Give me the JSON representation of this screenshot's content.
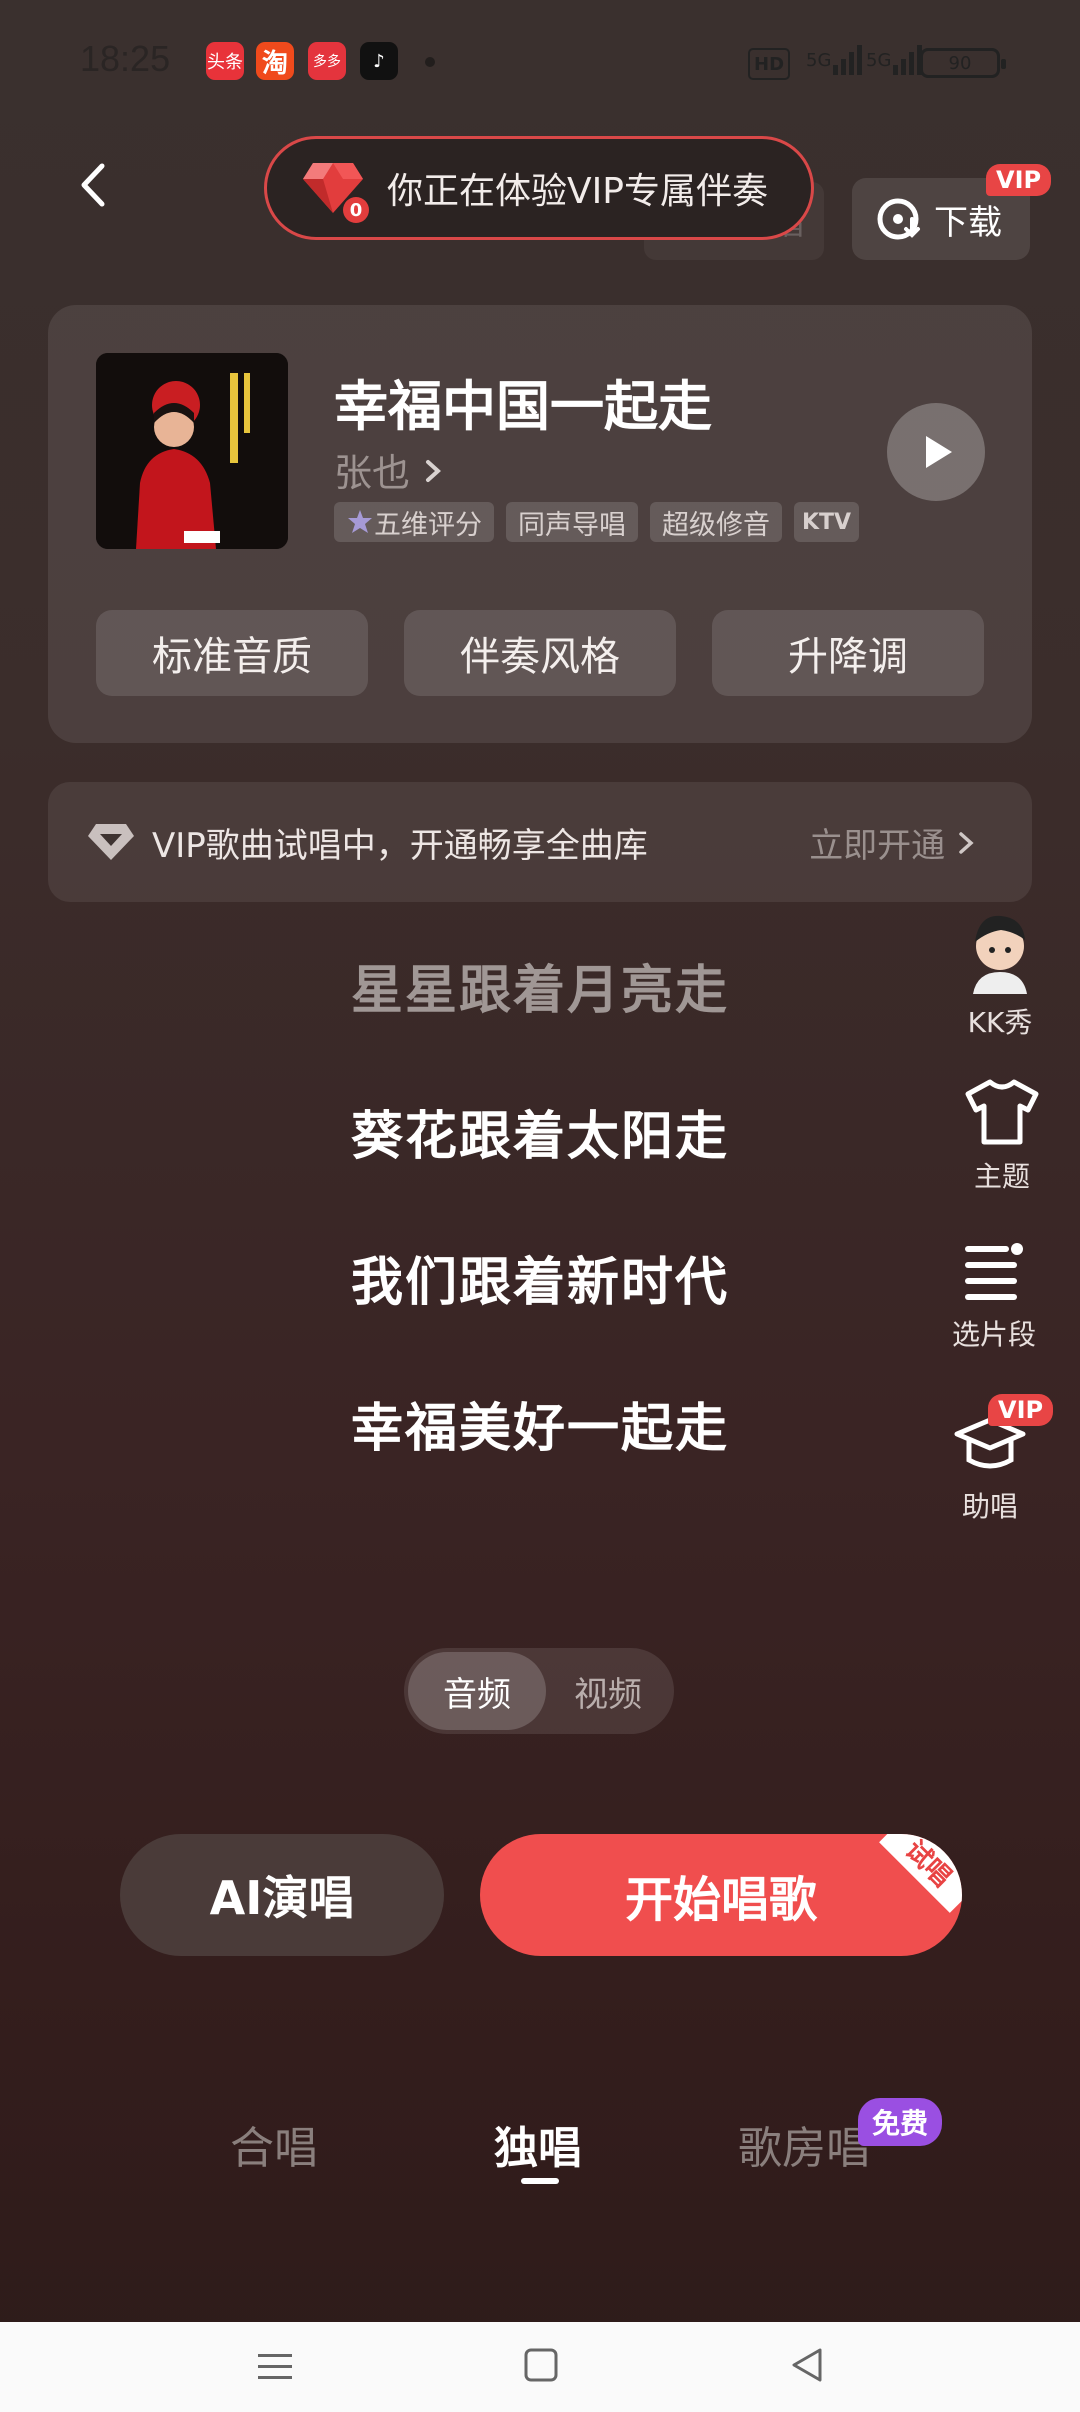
{
  "status_bar": {
    "time": "18:25",
    "apps": [
      {
        "label": "头条",
        "color": "#e8333a"
      },
      {
        "label": "淘",
        "color": "#f04a1c"
      },
      {
        "label": "多多",
        "color": "#e4343d"
      },
      {
        "label": "♪",
        "color": "#111111"
      }
    ],
    "hd": "HD",
    "network1": "5G",
    "network2": "5G",
    "battery": "90"
  },
  "header": {
    "vip_notice": "你正在体验VIP专属伴奏",
    "gem_count": "0",
    "practice_label": "练唱",
    "download_label": "下载",
    "download_badge": "VIP"
  },
  "song": {
    "title": "幸福中国一起走",
    "singer": "张也",
    "tags": [
      "五维评分",
      "同声导唱",
      "超级修音",
      "KTV"
    ],
    "options": [
      "标准音质",
      "伴奏风格",
      "升降调"
    ]
  },
  "vip_banner": {
    "text": "VIP歌曲试唱中，开通畅享全曲库",
    "link": "立即开通"
  },
  "lyrics": [
    {
      "text": "星星跟着月亮走",
      "active": false
    },
    {
      "text": "葵花跟着太阳走",
      "active": true
    },
    {
      "text": "我们跟着新时代",
      "active": true
    },
    {
      "text": "幸福美好一起走",
      "active": true
    }
  ],
  "side_tools": [
    {
      "label": "KK秀",
      "icon": "avatar-icon"
    },
    {
      "label": "主题",
      "icon": "tshirt-icon"
    },
    {
      "label": "选片段",
      "icon": "segment-icon"
    },
    {
      "label": "助唱",
      "icon": "graduation-cap-icon",
      "badge": "VIP"
    }
  ],
  "media_toggle": {
    "audio": "音频",
    "video": "视频",
    "selected": "音频"
  },
  "actions": {
    "ai_sing": "AI演唱",
    "start_sing": "开始唱歌",
    "trial_badge": "试唱"
  },
  "modes": {
    "chorus": "合唱",
    "solo": "独唱",
    "room": "歌房唱",
    "room_badge": "免费",
    "selected": "独唱"
  },
  "colors": {
    "accent_red": "#f04e4e",
    "vip_red": "#e84545",
    "free_purple": "#9a4fe2"
  }
}
